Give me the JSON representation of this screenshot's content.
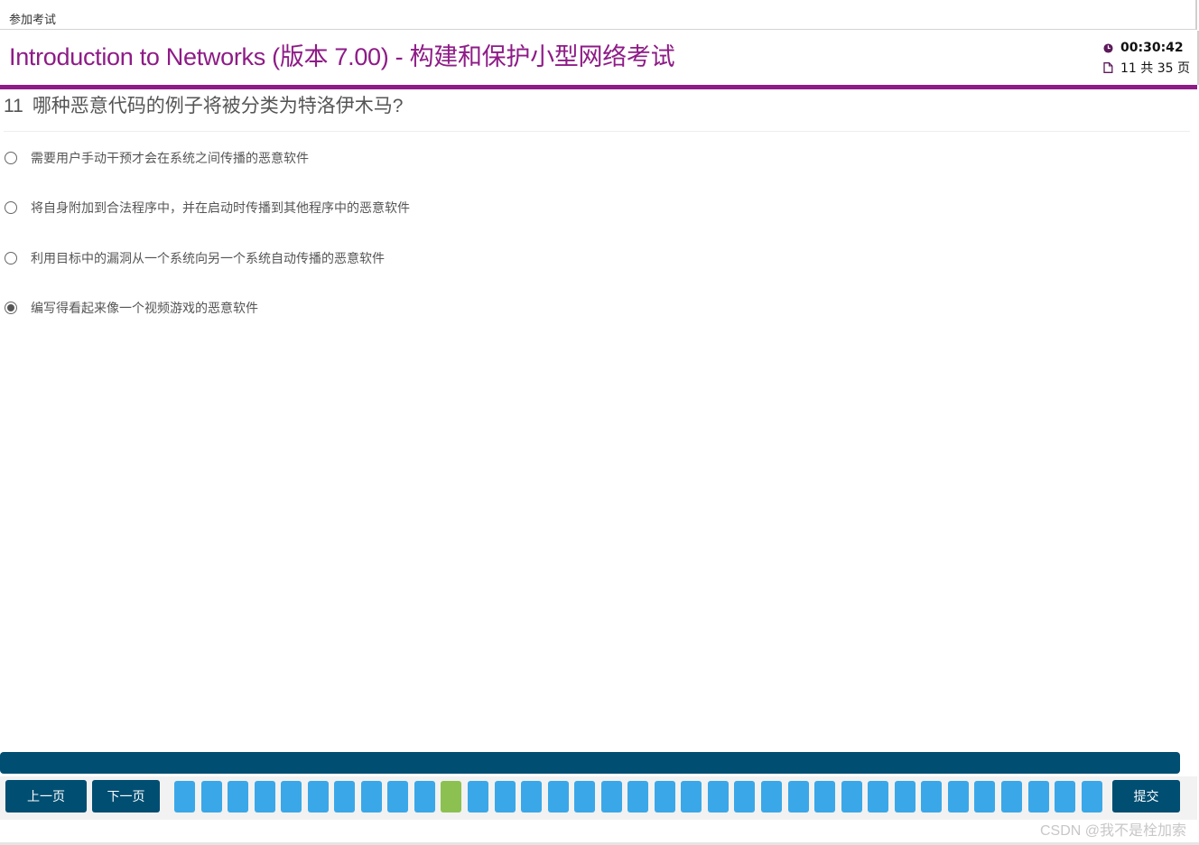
{
  "breadcrumb": "参加考试",
  "header": {
    "title": "Introduction to Networks (版本 7.00) - 构建和保护小型网络考试",
    "timer": "00:30:42",
    "page_indicator": "11 共 35 页"
  },
  "question": {
    "number": "11",
    "text": "哪种恶意代码的例子将被分类为特洛伊木马?",
    "options": [
      {
        "label": "需要用户手动干预才会在系统之间传播的恶意软件",
        "selected": false
      },
      {
        "label": "将自身附加到合法程序中，并在启动时传播到其他程序中的恶意软件",
        "selected": false
      },
      {
        "label": "利用目标中的漏洞从一个系统向另一个系统自动传播的恶意软件",
        "selected": false
      },
      {
        "label": "编写得看起来像一个视频游戏的恶意软件",
        "selected": true
      }
    ]
  },
  "navigation": {
    "prev_label": "上一页",
    "next_label": "下一页",
    "submit_label": "提交",
    "total_questions": 35,
    "current_question": 11
  },
  "watermark": "CSDN @我不是栓加索",
  "colors": {
    "accent": "#8e1b87",
    "nav": "#004e72",
    "tile": "#3aa8e8",
    "tile_current": "#8cc152"
  },
  "icons": {
    "timer": "clock-icon",
    "page": "document-icon"
  }
}
